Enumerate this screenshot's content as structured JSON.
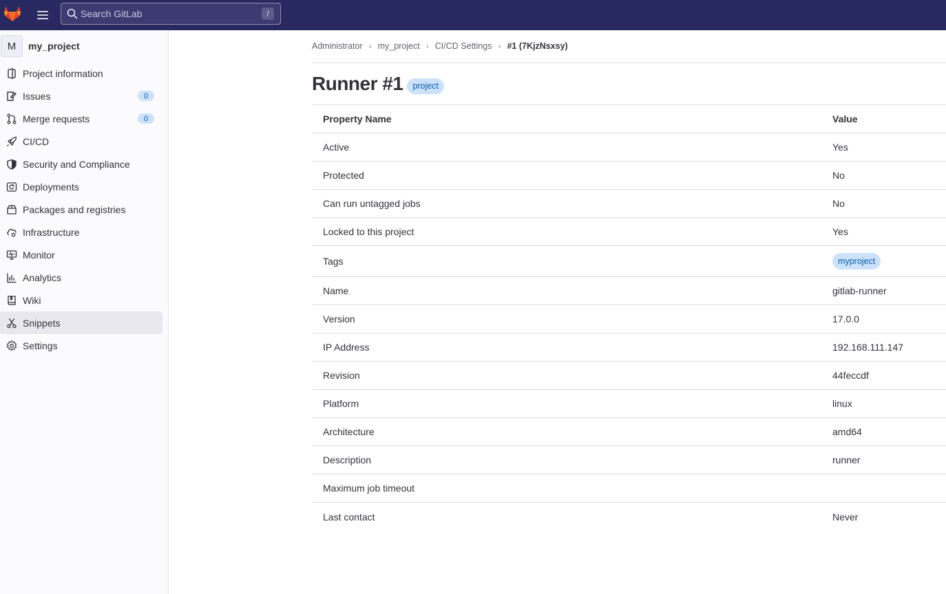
{
  "colors": {
    "topbar": "#292961",
    "accent_badge_bg": "#cbe2f9",
    "accent_badge_text": "#0b5cad",
    "sidebar_bg": "#fbfafd",
    "active_item_bg": "#e9e8ef"
  },
  "header": {
    "search_placeholder": "Search GitLab",
    "search_shortcut": "/"
  },
  "sidebar": {
    "project_initial": "M",
    "project_name": "my_project",
    "items": [
      {
        "label": "Project information",
        "icon": "project-icon"
      },
      {
        "label": "Issues",
        "icon": "issues-icon",
        "count": "0"
      },
      {
        "label": "Merge requests",
        "icon": "merge-request-icon",
        "count": "0"
      },
      {
        "label": "CI/CD",
        "icon": "rocket-icon"
      },
      {
        "label": "Security and Compliance",
        "icon": "shield-icon"
      },
      {
        "label": "Deployments",
        "icon": "deployments-icon"
      },
      {
        "label": "Packages and registries",
        "icon": "package-icon"
      },
      {
        "label": "Infrastructure",
        "icon": "cloud-gear-icon"
      },
      {
        "label": "Monitor",
        "icon": "monitor-icon"
      },
      {
        "label": "Analytics",
        "icon": "chart-icon"
      },
      {
        "label": "Wiki",
        "icon": "book-icon"
      },
      {
        "label": "Snippets",
        "icon": "snippet-icon",
        "active": true
      },
      {
        "label": "Settings",
        "icon": "settings-icon"
      }
    ]
  },
  "breadcrumb": {
    "items": [
      "Administrator",
      "my_project",
      "CI/CD Settings"
    ],
    "current": "#1 (7KjzNsxsy)"
  },
  "main": {
    "title": "Runner #1",
    "title_badge": "project",
    "table": {
      "header_name": "Property Name",
      "header_value": "Value",
      "rows": [
        {
          "name": "Active",
          "value": "Yes"
        },
        {
          "name": "Protected",
          "value": "No"
        },
        {
          "name": "Can run untagged jobs",
          "value": "No"
        },
        {
          "name": "Locked to this project",
          "value": "Yes"
        },
        {
          "name": "Tags",
          "tag": "myproject"
        },
        {
          "name": "Name",
          "value": "gitlab-runner"
        },
        {
          "name": "Version",
          "value": "17.0.0"
        },
        {
          "name": "IP Address",
          "value": "192.168.111.147"
        },
        {
          "name": "Revision",
          "value": "44feccdf"
        },
        {
          "name": "Platform",
          "value": "linux"
        },
        {
          "name": "Architecture",
          "value": "amd64"
        },
        {
          "name": "Description",
          "value": "runner"
        },
        {
          "name": "Maximum job timeout",
          "value": ""
        },
        {
          "name": "Last contact",
          "value": "Never"
        }
      ]
    }
  }
}
